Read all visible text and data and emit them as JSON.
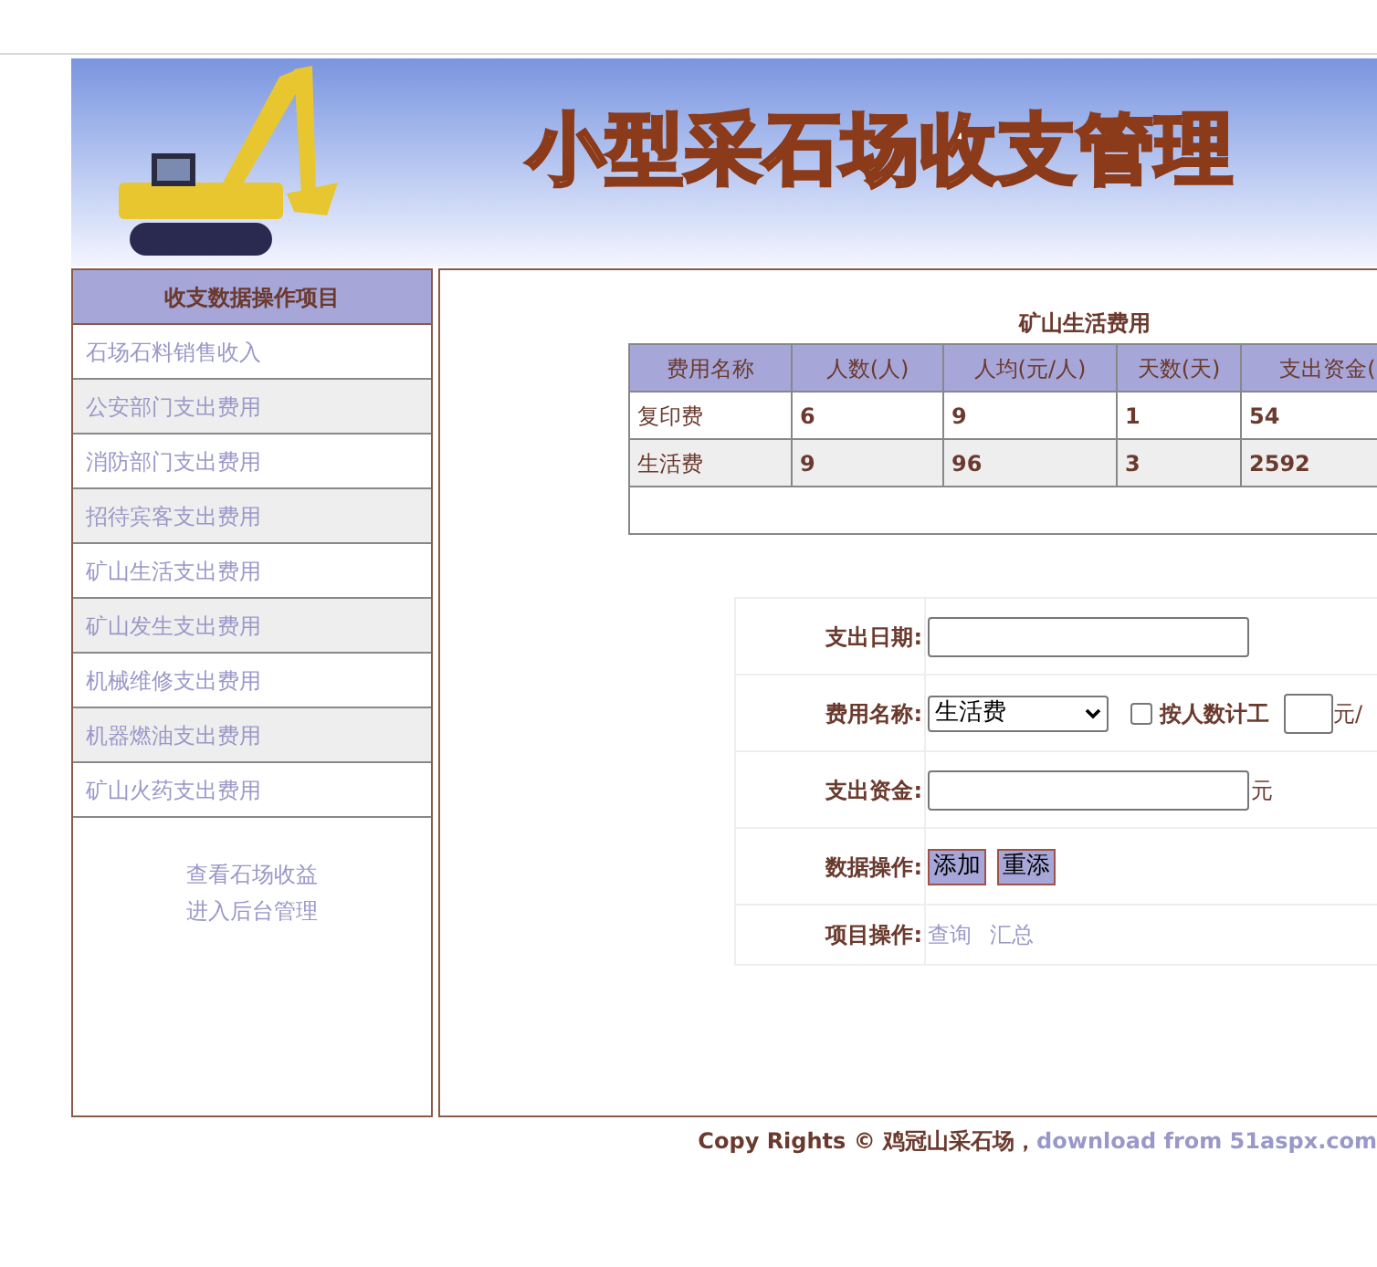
{
  "banner": {
    "title": "小型采石场收支管理"
  },
  "sidebar": {
    "header": "收支数据操作项目",
    "items": [
      {
        "label": "石场石料销售收入"
      },
      {
        "label": "公安部门支出费用"
      },
      {
        "label": "消防部门支出费用"
      },
      {
        "label": "招待宾客支出费用"
      },
      {
        "label": "矿山生活支出费用"
      },
      {
        "label": "矿山发生支出费用"
      },
      {
        "label": "机械维修支出费用"
      },
      {
        "label": "机器燃油支出费用"
      },
      {
        "label": "矿山火药支出费用"
      }
    ],
    "links": [
      "查看石场收益",
      "进入后台管理"
    ]
  },
  "table": {
    "title": "矿山生活费用",
    "columns": [
      "费用名称",
      "人数(人)",
      "人均(元/人)",
      "天数(天)",
      "支出资金("
    ],
    "rows": [
      [
        "复印费",
        "6",
        "9",
        "1",
        "54"
      ],
      [
        "生活费",
        "9",
        "96",
        "3",
        "2592"
      ]
    ]
  },
  "form": {
    "rows": [
      {
        "kind": "input",
        "label": "支出日期:"
      },
      {
        "kind": "select",
        "label": "费用名称:",
        "value": "生活费",
        "checkbox_label": "按人数计工",
        "checked": false,
        "unit": "元/"
      },
      {
        "kind": "input",
        "label": "支出资金:",
        "unit": "元"
      },
      {
        "kind": "buttons",
        "label": "数据操作:",
        "buttons": [
          "添加",
          "重添"
        ]
      },
      {
        "kind": "links",
        "label": "项目操作:",
        "links": [
          "查询",
          "汇总"
        ]
      }
    ]
  },
  "footer": {
    "text": "Copy Rights © 鸡冠山采石场，",
    "link": "download from 51aspx.com"
  }
}
